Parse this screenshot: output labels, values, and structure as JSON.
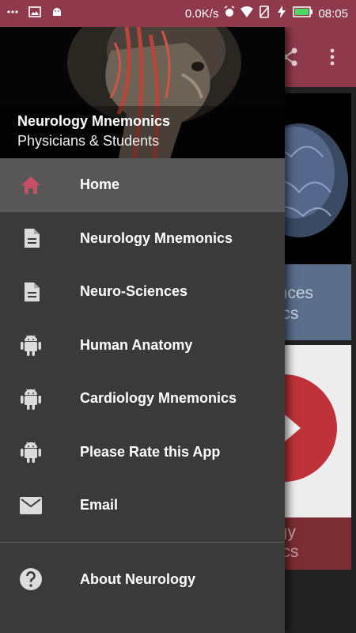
{
  "status_bar": {
    "speed": "0.0K/s",
    "time": "08:05",
    "colors": {
      "bg": "#8e3a4c"
    }
  },
  "drawer": {
    "header": {
      "title": "Neurology Mnemonics",
      "subtitle": "Physicians & Students"
    },
    "items": [
      {
        "label": "Home",
        "icon": "home-icon",
        "active": true
      },
      {
        "label": "Neurology Mnemonics",
        "icon": "document-icon"
      },
      {
        "label": "Neuro-Sciences",
        "icon": "document-icon"
      },
      {
        "label": "Human Anatomy",
        "icon": "android-icon"
      },
      {
        "label": "Cardiology Mnemonics",
        "icon": "android-icon"
      },
      {
        "label": "Please Rate this App",
        "icon": "android-icon"
      },
      {
        "label": "Email",
        "icon": "mail-icon"
      }
    ],
    "footer_item": {
      "label": "About Neurology",
      "icon": "help-icon"
    }
  },
  "background": {
    "card_blue_text": [
      "ences",
      "nics"
    ],
    "card_red_text": [
      "ogy",
      "nics"
    ]
  },
  "colors": {
    "accent": "#8e3a4c",
    "home_icon": "#c44f66",
    "drawer_bg": "#3a3a3a",
    "active_bg": "#575757"
  }
}
